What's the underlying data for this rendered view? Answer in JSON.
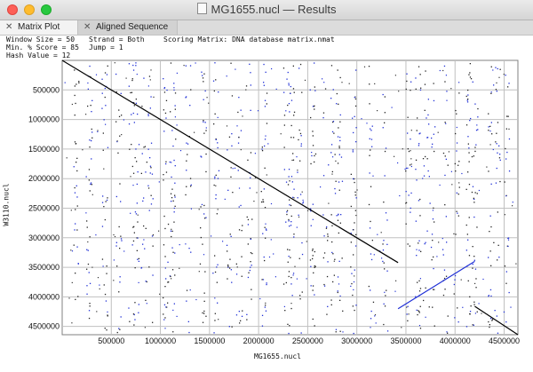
{
  "window": {
    "title": "MG1655.nucl — Results"
  },
  "tabs": [
    {
      "label": "Matrix Plot",
      "active": true
    },
    {
      "label": "Aligned Sequence",
      "active": false
    }
  ],
  "info": {
    "window_size": "Window Size = 50",
    "strand": "Strand = Both",
    "scoring_matrix": "Scoring Matrix: DNA database matrix.nmat",
    "min_score": "Min. % Score = 85",
    "jump": "Jump = 1",
    "hash_value": "Hash Value = 12"
  },
  "colors": {
    "forward": "#000000",
    "reverse": "#1f2fd6",
    "grid": "#c0c0c0"
  },
  "chart_data": {
    "type": "scatter",
    "xlabel": "MG1655.nucl",
    "ylabel": "W3110.nucl",
    "xlim": [
      0,
      4640000
    ],
    "ylim": [
      0,
      4640000
    ],
    "y_inverted": true,
    "grid": true,
    "x_ticks": [
      500000,
      1000000,
      1500000,
      2000000,
      2500000,
      3000000,
      3500000,
      4000000,
      4500000
    ],
    "y_ticks": [
      500000,
      1000000,
      1500000,
      2000000,
      2500000,
      3000000,
      3500000,
      4000000,
      4500000
    ],
    "x_tick_labels": [
      "500000",
      "1000000",
      "1500000",
      "2000000",
      "2500000",
      "3000000",
      "3500000",
      "4000000",
      "4500000"
    ],
    "y_tick_labels": [
      "500000",
      "1000000",
      "1500000",
      "2000000",
      "2500000",
      "3000000",
      "3500000",
      "4000000",
      "4500000"
    ],
    "series": [
      {
        "strand": "forward",
        "color": "#000000",
        "points": [
          [
            0,
            0
          ],
          [
            3420000,
            3420000
          ]
        ]
      },
      {
        "strand": "reverse",
        "color": "#1f2fd6",
        "points": [
          [
            3420000,
            4200000
          ],
          [
            4200000,
            3400000
          ]
        ]
      },
      {
        "strand": "forward",
        "color": "#000000",
        "points": [
          [
            4200000,
            4160000
          ],
          [
            4640000,
            4640000
          ]
        ]
      }
    ],
    "scatter_columns_x": [
      140000,
      270000,
      430000,
      570000,
      700000,
      750000,
      830000,
      900000,
      1050000,
      1120000,
      1280000,
      1430000,
      1560000,
      1700000,
      1800000,
      1900000,
      2050000,
      2280000,
      2330000,
      2420000,
      2550000,
      2680000,
      2760000,
      2820000,
      2960000,
      3140000,
      3280000,
      3520000,
      3620000,
      3700000,
      3760000,
      3900000,
      4010000,
      4140000,
      4200000,
      4360000,
      4430000,
      4520000
    ]
  }
}
